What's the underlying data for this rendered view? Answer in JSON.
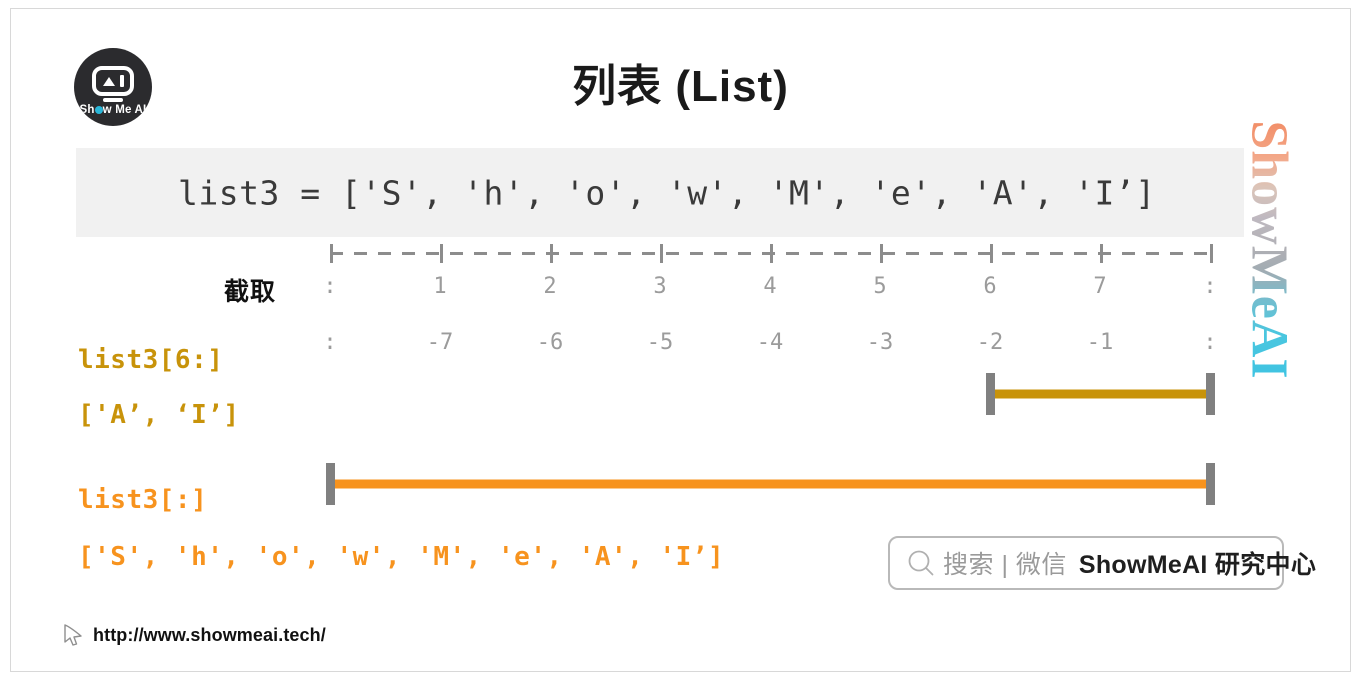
{
  "slide": {
    "title": "列表 (List)",
    "background": "#ffffff",
    "border_color": "#d8d8d8"
  },
  "logo": {
    "name": "show-me-ai-logo",
    "text_before_o": "Sh",
    "text_after_o": "w Me AI",
    "background": "#2b2b2e",
    "eye_color": "#29b6d8"
  },
  "watermark": {
    "text": "ShowMeAI",
    "orientation": "vertical",
    "gradient_from": "#f0845a",
    "gradient_to": "#2ec0e0"
  },
  "code_band": {
    "code": "list3 = ['S', 'h', 'o', 'w', 'M', 'e', 'A', 'I’]",
    "background": "#f1f1f1",
    "text_color": "#3a3a3a"
  },
  "ruler": {
    "section_label": "截取",
    "line_color": "#8c8c8c",
    "tick_count": 9,
    "positive_indices": [
      ":",
      "1",
      "2",
      "3",
      "4",
      "5",
      "6",
      "7",
      ":"
    ],
    "negative_indices": [
      ":",
      "-7",
      "-6",
      "-5",
      "-4",
      "-3",
      "-2",
      "-1",
      ":"
    ],
    "index_text_color": "#9b9b9b"
  },
  "slices": [
    {
      "expression": "list3[6:]",
      "result": "['A’, ‘I’]",
      "color": "#c8930a",
      "cap_color": "#808080",
      "bar_start_index": 6,
      "bar_end_index": 8
    },
    {
      "expression": "list3[:]",
      "result": "['S', 'h', 'o', 'w', 'M', 'e', 'A', 'I’]",
      "color": "#f7931e",
      "cap_color": "#808080",
      "bar_start_index": 0,
      "bar_end_index": 8
    }
  ],
  "badge": {
    "icon": "search-icon",
    "grey_text": "搜索 | 微信",
    "dark_text": "ShowMeAI 研究中心",
    "border_color": "#b9b9b9"
  },
  "footer": {
    "icon": "cursor-icon",
    "url": "http://www.showmeai.tech/"
  }
}
